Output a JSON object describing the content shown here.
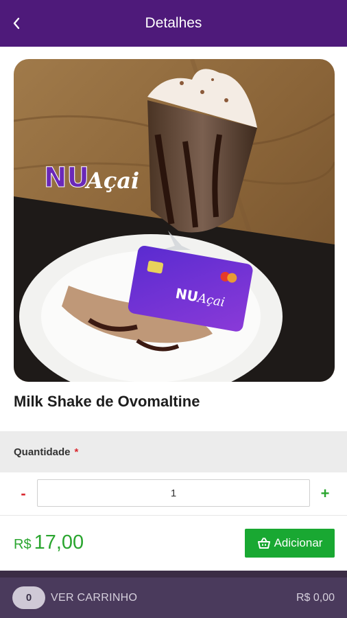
{
  "header": {
    "title": "Detalhes",
    "back_icon": "chevron-left-icon"
  },
  "product": {
    "name": "Milk Shake de Ovomaltine",
    "image_logo_text": "NUAçai",
    "price_currency": "R$",
    "price_value": "17,00"
  },
  "quantity": {
    "label": "Quantidade",
    "required_mark": "*",
    "value": "1",
    "minus_label": "-",
    "plus_label": "+"
  },
  "actions": {
    "add_label": "Adicionar",
    "add_icon": "basket-icon"
  },
  "cart": {
    "count": "0",
    "label": "VER CARRINHO",
    "total": "R$ 0,00"
  },
  "colors": {
    "header_bg": "#4e1a7a",
    "accent_green": "#2aa52f",
    "button_green": "#19a832",
    "required_red": "#d9282f",
    "cart_bar_bg": "#4a3a5c"
  }
}
